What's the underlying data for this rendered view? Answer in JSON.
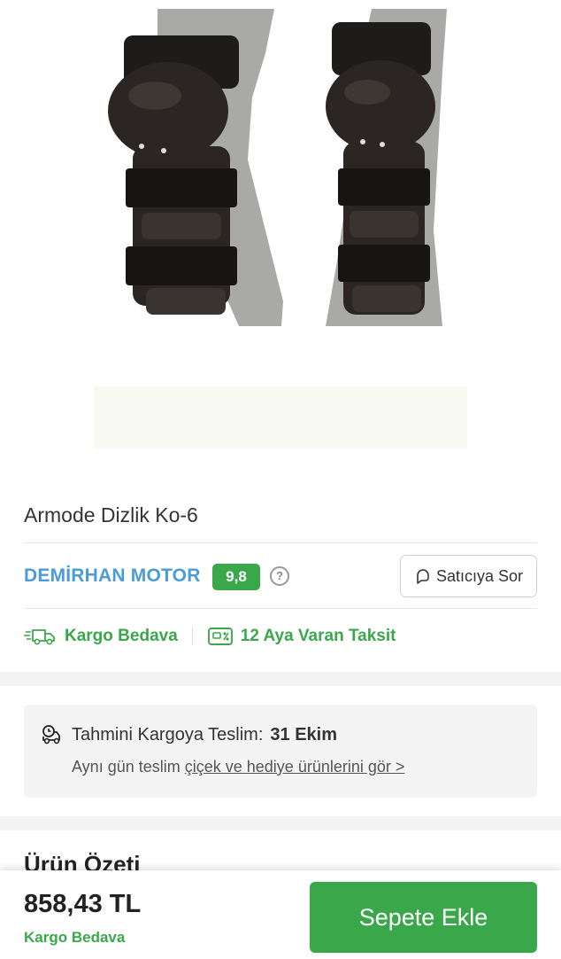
{
  "product": {
    "title": "Armode Dizlik Ko-6",
    "image_subject": "knee-guard-pair-photo"
  },
  "seller": {
    "name": "DEMİRHAN MOTOR",
    "score": "9,8",
    "ask_button_label": "Satıcıya Sor"
  },
  "benefits": {
    "shipping": "Kargo Bedava",
    "installment": "12 Aya Varan Taksit"
  },
  "delivery": {
    "label": "Tahmini Kargoya Teslim:",
    "date": "31 Ekim",
    "sameday_text": "Aynı gün teslim",
    "sameday_link": "çiçek ve hediye ürünlerini gör >"
  },
  "summary": {
    "title": "Ürün Özeti"
  },
  "bottom_bar": {
    "price": "858,43 TL",
    "shipping": "Kargo Bedava",
    "add_to_cart_label": "Sepete Ekle"
  },
  "colors": {
    "accent_green": "#3aa84a",
    "seller_blue": "#4a9bd8",
    "guard_dark": "#2b2623",
    "denim_gray": "#a9aaa8"
  },
  "icons": {
    "shipping": "truck-icon",
    "installment": "installment-card-icon",
    "delivery": "delivery-truck-icon",
    "ask_seller": "chat-bubble-icon",
    "help": "question-circle-icon"
  }
}
